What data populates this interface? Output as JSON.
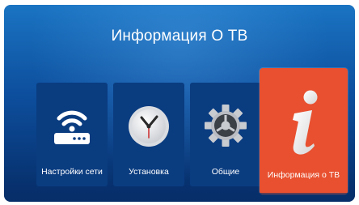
{
  "header": {
    "title": "Информация О ТВ"
  },
  "menu": {
    "items": [
      {
        "label": "Настройки сети",
        "icon": "router-wifi-icon"
      },
      {
        "label": "Установка",
        "icon": "clock-icon"
      },
      {
        "label": "Общие",
        "icon": "gear-icon"
      },
      {
        "label": "Информация о ТВ",
        "icon": "info-icon",
        "selected": true
      }
    ]
  },
  "colors": {
    "background": "#0d4f9e",
    "tile": "#0a3c80",
    "selected_tile": "#e8502f"
  }
}
